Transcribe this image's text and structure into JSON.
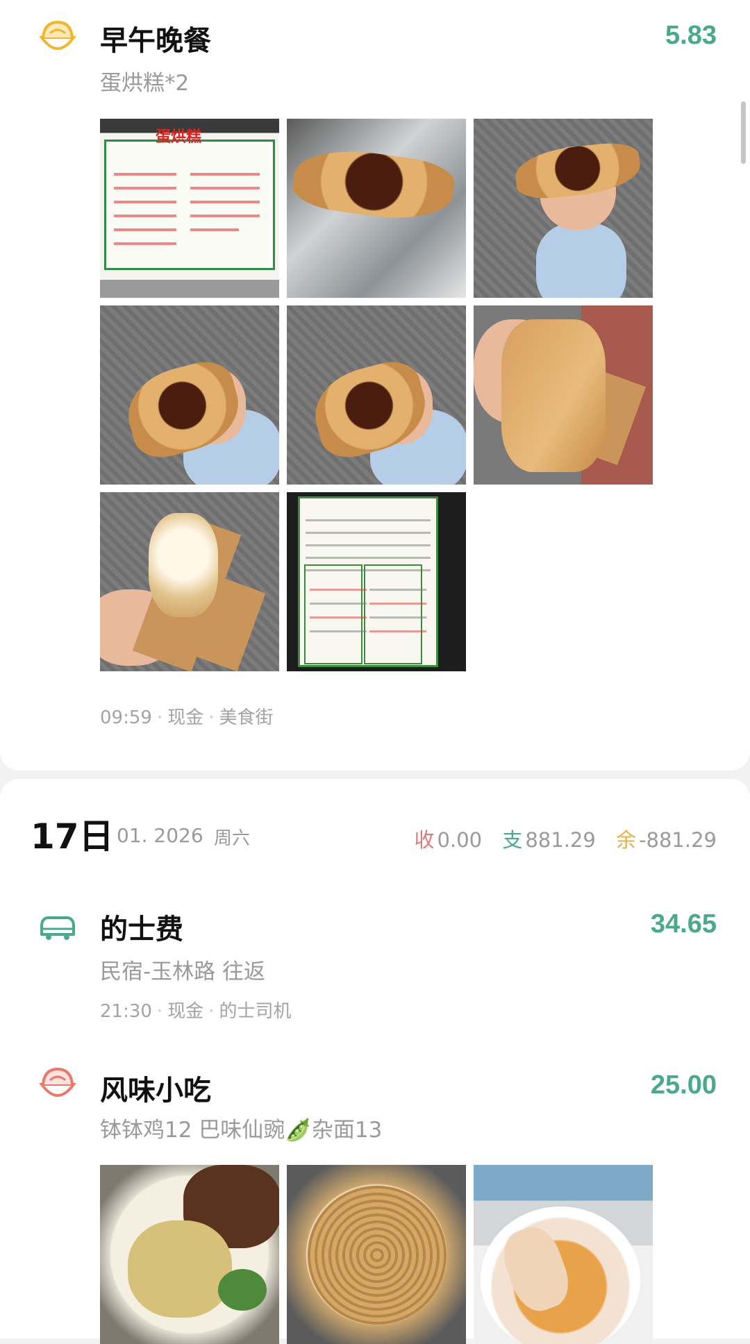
{
  "colors": {
    "amount": "#4aa98a",
    "income_key": "#e07a78",
    "expense_key": "#4aa98a",
    "balance_key": "#e3b248",
    "icon_food": "#f2b531",
    "icon_snack": "#e8796d",
    "icon_taxi": "#4aa98a"
  },
  "entries": [
    {
      "icon": "rice-bowl-icon",
      "title": "早午晚餐",
      "note": "蛋烘糕*2",
      "amount": "5.83",
      "time": "09:59",
      "account": "现金",
      "merchant": "美食街",
      "photos": 8
    },
    {
      "icon": "car-icon",
      "title": "的士费",
      "note": "民宿-玉林路 往返",
      "amount": "34.65",
      "time": "21:30",
      "account": "现金",
      "merchant": "的士司机"
    },
    {
      "icon": "rice-bowl-icon",
      "title": "风味小吃",
      "note": "钵钵鸡12 巴味仙豌🫛杂面13",
      "amount": "25.00",
      "photos": 3
    }
  ],
  "day": {
    "num": "17日",
    "date": "01. 2026",
    "weekday": "周六",
    "income_label": "收",
    "income": "0.00",
    "expense_label": "支",
    "expense": "881.29",
    "balance_label": "余",
    "balance": "-881.29"
  }
}
